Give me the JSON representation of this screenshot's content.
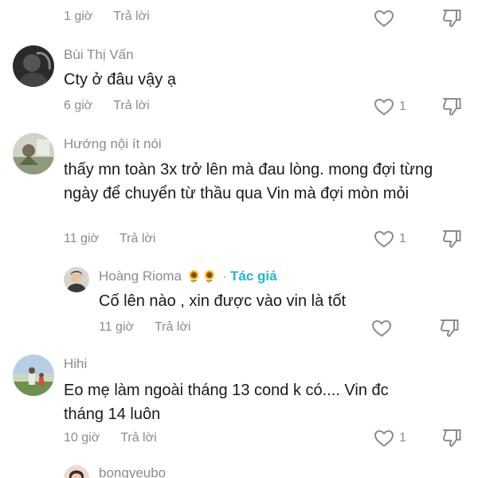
{
  "comments": [
    {
      "username": "",
      "text": "",
      "time": "1 giờ",
      "reply": "Trả lời",
      "likes": ""
    },
    {
      "username": "Bùi Thị Vấn",
      "text": "Cty ở đâu vậy ạ",
      "time": "6 giờ",
      "reply": "Trả lời",
      "likes": "1"
    },
    {
      "username": "Hướng nội ít nói",
      "text": "thấy mn toàn 3x trở lên mà đau lòng. mong đợi từng ngày để chuyển từ thầu qua Vin mà đợi mòn mỏi",
      "time": "11 giờ",
      "reply": "Trả lời",
      "likes": "1"
    },
    {
      "username": "Hoàng Rioma",
      "emoji": "🌻🌻",
      "author_badge": "Tác giả",
      "separator": "·",
      "text": "Cố lên nào , xin được vào vin là tốt",
      "time": "11 giờ",
      "reply": "Trả lời",
      "likes": ""
    },
    {
      "username": "Hihi",
      "text": "Eo mẹ làm ngoài tháng 13 cond k có.... Vin đc tháng 14 luôn",
      "time": "10 giờ",
      "reply": "Trả lời",
      "likes": "1"
    },
    {
      "username": "bongyeubo",
      "text": "",
      "time": "",
      "reply": "",
      "likes": ""
    }
  ],
  "icons": {
    "like": "heart-outline-icon",
    "dislike": "thumbs-down-outline-icon"
  },
  "colors": {
    "text": "#161823",
    "muted": "#8a8b91",
    "author_badge": "#20b7c9",
    "icon": "#8a8b91"
  }
}
